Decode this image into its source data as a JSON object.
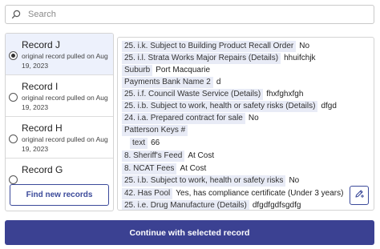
{
  "search": {
    "placeholder": "Search"
  },
  "records": [
    {
      "title": "Record J",
      "line1": "original record pulled on Aug",
      "line2": "19, 2023",
      "selected": true
    },
    {
      "title": "Record I",
      "line1": "original record pulled on Aug",
      "line2": "19, 2023",
      "selected": false
    },
    {
      "title": "Record H",
      "line1": "original record pulled on Aug",
      "line2": "19, 2023",
      "selected": false
    },
    {
      "title": "Record G",
      "line1": "",
      "line2": "",
      "selected": false
    }
  ],
  "find_button": {
    "label": "Find new records"
  },
  "fields": [
    {
      "label": "25. i.k. Subject to Building Product Recall Order",
      "value": "No"
    },
    {
      "label": "25. i.l. Strata Works Major Repairs (Details)",
      "value": "hhuifchjk"
    },
    {
      "label": "Suburb",
      "value": "Port Macquarie"
    },
    {
      "label": "Payments Bank Name 2",
      "value": "d"
    },
    {
      "label": "25. i.f. Council Waste Service (Details)",
      "value": "fhxfghxfgh"
    },
    {
      "label": "25. i.b. Subject to work, health or safety risks (Details)",
      "value": "dfgd"
    },
    {
      "label": "24. i.a. Prepared contract for sale",
      "value": "No"
    },
    {
      "label": "Patterson Keys #",
      "value": ""
    },
    {
      "label": "text",
      "value": "66"
    },
    {
      "label": "8. Sheriff's Feed",
      "value": "At Cost"
    },
    {
      "label": "8. NCAT Fees",
      "value": "At Cost"
    },
    {
      "label": "25. i.b. Subject to work, health or safety risks",
      "value": "No"
    },
    {
      "label": "42. Has Pool",
      "value": "Yes, has compliance certificate (Under 3 years)"
    },
    {
      "label": "25. i.e. Drug Manufacture (Details)",
      "value": "dfgdfgdfsgdfg"
    }
  ],
  "continue_button": {
    "label": "Continue with selected record"
  },
  "icons": {
    "search": "search-icon",
    "edit": "edit-pencil-icon",
    "radio": "radio-icon"
  },
  "colors": {
    "accent": "#3b4192",
    "selected_bg": "#edf1fc",
    "label_bg": "#e8ebf6"
  }
}
